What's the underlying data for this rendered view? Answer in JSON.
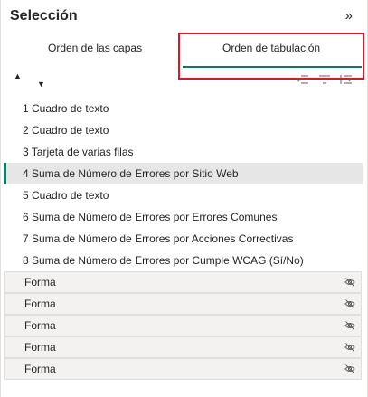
{
  "header": {
    "title": "Selección",
    "collapse_icon": "chevron-double-right-icon"
  },
  "tabs": [
    {
      "label": "Orden de las capas",
      "active": false
    },
    {
      "label": "Orden de tabulación",
      "active": true
    }
  ],
  "accent_color": "#117865",
  "highlight_color": "#e81123",
  "toolbar": {
    "move_up_icon": "triangle-up-icon",
    "move_down_icon": "triangle-down-icon",
    "tools": [
      "remove-tab-order-icon",
      "sort-icon",
      "tab-order-icon"
    ]
  },
  "items": [
    {
      "label": "1 Cuadro de texto",
      "selected": false
    },
    {
      "label": "2 Cuadro de texto",
      "selected": false
    },
    {
      "label": "3 Tarjeta de varias filas",
      "selected": false
    },
    {
      "label": "4 Suma de Número de Errores por Sitio Web",
      "selected": true
    },
    {
      "label": "5 Cuadro de texto",
      "selected": false
    },
    {
      "label": "6 Suma de Número de Errores por Errores Comunes",
      "selected": false
    },
    {
      "label": "7 Suma de Número de Errores por Acciones Correctivas",
      "selected": false
    },
    {
      "label": "8 Suma de Número de Errores por Cumple WCAG (Sí/No)",
      "selected": false
    }
  ],
  "shapes": [
    {
      "label": "Forma",
      "icon": "eye-hidden-icon"
    },
    {
      "label": "Forma",
      "icon": "eye-hidden-icon"
    },
    {
      "label": "Forma",
      "icon": "eye-hidden-icon"
    },
    {
      "label": "Forma",
      "icon": "eye-hidden-icon"
    },
    {
      "label": "Forma",
      "icon": "eye-hidden-icon"
    }
  ]
}
